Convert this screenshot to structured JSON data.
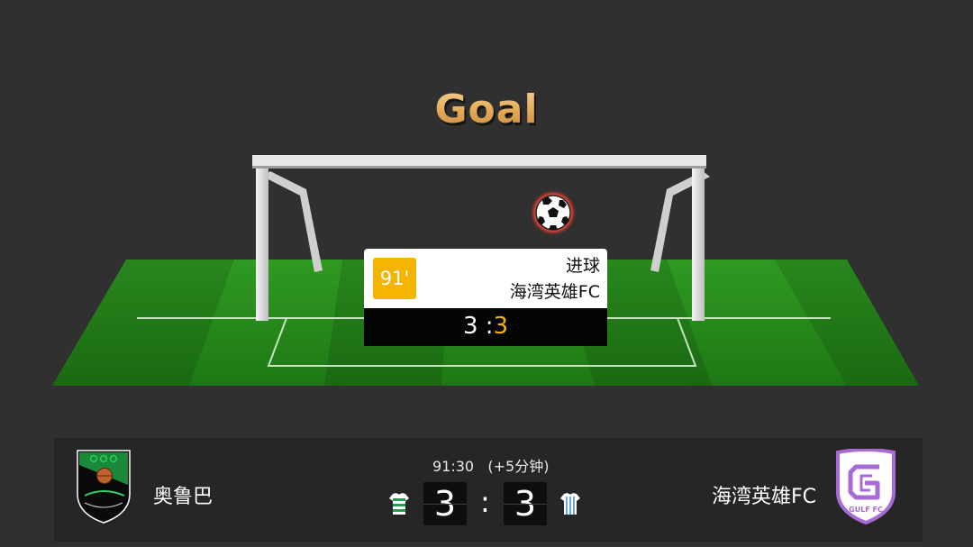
{
  "title": "Goal",
  "event": {
    "minute": "91'",
    "type": "进球",
    "team": "海湾英雄FC",
    "score_home": "3",
    "score_sep": " :",
    "score_away": "3"
  },
  "match": {
    "time": "91:30",
    "added_time": "(+5分钟)",
    "home_team": "奥鲁巴",
    "away_team": "海湾英雄FC",
    "home_score": "3",
    "away_score": "3",
    "separator": ":",
    "away_badge_text": "GULF FC"
  },
  "colors": {
    "accent": "#f4b400",
    "pitch": "#2e8b1f",
    "background": "#303030",
    "bar": "#262626",
    "away_badge": "#a86ad6"
  }
}
